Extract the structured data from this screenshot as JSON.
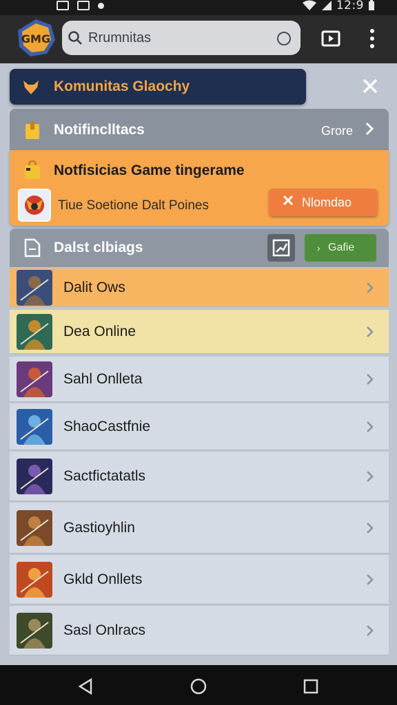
{
  "status_bar": {
    "time": "12:9",
    "icons": [
      "gallery-icon",
      "screenshot-icon",
      "dot-icon",
      "wifi-icon",
      "signal-icon",
      "battery-icon"
    ]
  },
  "app_bar": {
    "logo_text": "GMG",
    "search_value": "Rrumnitas",
    "icons": [
      "search-icon",
      "mic-icon",
      "cast-icon",
      "more-vert-icon"
    ]
  },
  "banner": {
    "title": "Komunitas Glaochy",
    "icon": "fox-icon",
    "close_icon": "close-icon"
  },
  "notifications": {
    "header_title": "Notifinclltacs",
    "header_link": "Grore",
    "card_title": "Notfisicias Game tingerame",
    "card_text": "Tiue Soetione Dalt Poines",
    "card_button": "Nlomdao",
    "colors": {
      "card": "#f7a64c",
      "button": "#ef7d3e"
    }
  },
  "game_list": {
    "header_title": "Dalst clbiags",
    "header_button": "Gafie",
    "items": [
      {
        "label": "Dalit Ows",
        "highlight": "#f7b562",
        "thumb": [
          "#3b4e7a",
          "#8a6a4a"
        ]
      },
      {
        "label": "Dea Online",
        "highlight": "#f1e2a6",
        "thumb": [
          "#2e6a54",
          "#c48a2e"
        ]
      },
      {
        "label": "Sahl Onlleta",
        "highlight": "",
        "thumb": [
          "#6a3a7a",
          "#c65a3a"
        ]
      },
      {
        "label": "ShaoCastfnie",
        "highlight": "",
        "thumb": [
          "#2a5ea8",
          "#6ab0e0"
        ]
      },
      {
        "label": "Sactfictatatls",
        "highlight": "",
        "thumb": [
          "#2a2a5a",
          "#7a5ab0"
        ]
      },
      {
        "label": "Gastioyhlin",
        "highlight": "",
        "thumb": [
          "#7a4a2a",
          "#c08040"
        ]
      },
      {
        "label": "Gkld Onllets",
        "highlight": "",
        "thumb": [
          "#c04a20",
          "#f0a040"
        ]
      },
      {
        "label": "Sasl Onlracs",
        "highlight": "",
        "thumb": [
          "#3e4a2a",
          "#9a8a5a"
        ]
      }
    ]
  },
  "nav_bar": {
    "icons": [
      "back-icon",
      "home-icon",
      "recents-icon"
    ]
  }
}
